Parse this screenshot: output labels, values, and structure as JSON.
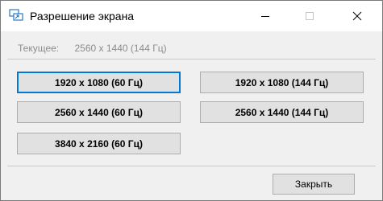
{
  "window": {
    "title": "Разрешение экрана",
    "icon": "display-settings-icon"
  },
  "current": {
    "label": "Текущее:",
    "value": "2560 x 1440 (144 Гц)"
  },
  "resolutions": [
    {
      "label": "1920 x 1080 (60 Гц)",
      "focused": true
    },
    {
      "label": "1920 x 1080 (144 Гц)",
      "focused": false
    },
    {
      "label": "2560 x 1440 (60 Гц)",
      "focused": false
    },
    {
      "label": "2560 x 1440 (144 Гц)",
      "focused": false
    },
    {
      "label": "3840 x 2160 (60 Гц)",
      "focused": false
    }
  ],
  "footer": {
    "close_label": "Закрыть"
  },
  "colors": {
    "accent": "#0078d7"
  }
}
